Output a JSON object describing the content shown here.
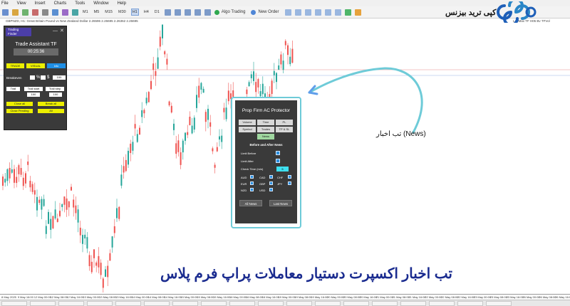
{
  "menu": [
    "File",
    "View",
    "Insert",
    "Charts",
    "Tools",
    "Window",
    "Help"
  ],
  "toolbar": {
    "timeframes": [
      "M1",
      "M5",
      "M15",
      "M30",
      "H1",
      "H4",
      "D1"
    ],
    "active_timeframe": "H1",
    "algo_trading": "Algo Trading",
    "new_order": "New Order"
  },
  "chart": {
    "symbol_info": "GBPNZD, H1:  Great Britain Pound vs New Zealand Dollar  2.26596 2.26695 2.26362 2.26695",
    "right_info": "Lot Max TF H05 Bv TFVol",
    "time_labels": [
      "8 May 2025",
      "9 May 16:00",
      "12 May 00:00",
      "12 May 08:00",
      "12 May 16:00",
      "13 May 00:00",
      "13 May 08:00",
      "13 May 16:00",
      "14 May 00:00",
      "14 May 08:00",
      "14 May 16:00",
      "15 May 00:00",
      "15 May 08:00",
      "15 May 16:00",
      "16 May 00:00",
      "16 May 08:00",
      "16 May 16:00",
      "19 May 00:00",
      "19 May 08:00",
      "19 May 16:00",
      "20 May 00:00",
      "20 May 08:00",
      "20 May 16:00",
      "21 May 00:00",
      "21 May 08:00",
      "21 May 16:00",
      "22 May 00:00",
      "22 May 08:00",
      "22 May 16:00",
      "23 May 00:00",
      "23 May 08:00",
      "23 May 16:00",
      "26 May 00:00",
      "26 May 08:00",
      "26 May 16:00"
    ]
  },
  "trade_assistant": {
    "logo": "Trading\nFinder",
    "minimize": "—",
    "close": "✕",
    "title": "Trade Assistant TF",
    "timer": "00:25:36",
    "modes": [
      "TRADE",
      "VISUAL",
      "info"
    ],
    "breakeven_label": "Breakeven",
    "percent_btn": "%",
    "dollar_btn": "$",
    "breakeven_value": "100",
    "trail_label": "Trail",
    "trail_start_label": "Trail start",
    "trail_step_label": "Trail step",
    "trail_start_value": "100",
    "trail_step_value": "100",
    "close_all": "Close all",
    "break_all": "Break all",
    "close_pending": "Close Pending",
    "all": "All"
  },
  "prop_firm": {
    "title": "Prop Firm AC Protector",
    "tabs": [
      "Volume",
      "Time",
      "PL",
      "Symbol",
      "Trades",
      "TP & SL",
      "News"
    ],
    "active_tab": "News",
    "section_title": "Before and After News",
    "limit_before": "Limit Before",
    "limit_after": "Limit After",
    "check_time": "Check Time (min)",
    "check_time_value": "5",
    "currencies": [
      "AUD",
      "CAD",
      "CHF",
      "EUR",
      "GBP",
      "JPY",
      "NZD",
      "USD"
    ],
    "all_news": "All News",
    "last_news": "Last News"
  },
  "annotation": {
    "label": "تب اخبار (News)",
    "arrow_color": "#5f9eea",
    "curve_color": "#6ecbd8"
  },
  "brand": {
    "name": "کپی ترید بیزنس",
    "logo_color": "#1e5fb8"
  },
  "caption": "تب اخبار اکسپرت دستیار معاملات پراپ فرم پلاس",
  "colors": {
    "bull": "#26a69a",
    "bear": "#ef5350",
    "caption": "#1a2b8f"
  }
}
